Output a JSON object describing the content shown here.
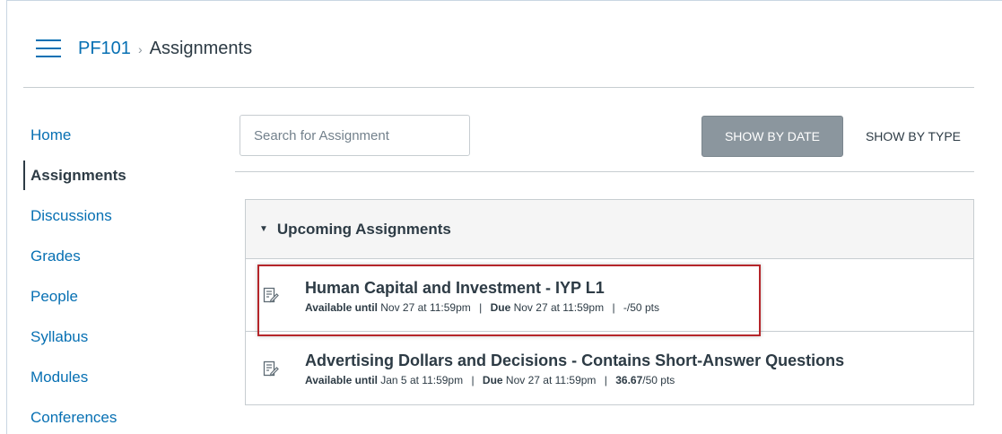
{
  "breadcrumb": {
    "course": "PF101",
    "separator": "›",
    "current": "Assignments"
  },
  "sidebar": {
    "items": [
      {
        "label": "Home"
      },
      {
        "label": "Assignments"
      },
      {
        "label": "Discussions"
      },
      {
        "label": "Grades"
      },
      {
        "label": "People"
      },
      {
        "label": "Syllabus"
      },
      {
        "label": "Modules"
      },
      {
        "label": "Conferences"
      }
    ]
  },
  "toolbar": {
    "search_placeholder": "Search for Assignment",
    "show_by_date": "SHOW BY DATE",
    "show_by_type": "SHOW BY TYPE"
  },
  "group": {
    "caret": "▼",
    "title": "Upcoming Assignments",
    "assignments": [
      {
        "title": "Human Capital and Investment - IYP L1",
        "available_label": "Available until",
        "available_value": "Nov 27 at 11:59pm",
        "due_label": "Due",
        "due_value": "Nov 27 at 11:59pm",
        "score": "-",
        "points": "/50 pts"
      },
      {
        "title": "Advertising Dollars and Decisions - Contains Short-Answer Questions",
        "available_label": "Available until",
        "available_value": "Jan 5 at 11:59pm",
        "due_label": "Due",
        "due_value": "Nov 27 at 11:59pm",
        "score": "36.67",
        "points": "/50 pts"
      }
    ]
  },
  "colors": {
    "link": "#0770b3",
    "text": "#2d3b45",
    "button_active_bg": "#8b969e",
    "highlight": "#b5262a"
  },
  "icons": {
    "menu": "hamburger-icon",
    "assignment": "assignment-icon"
  }
}
